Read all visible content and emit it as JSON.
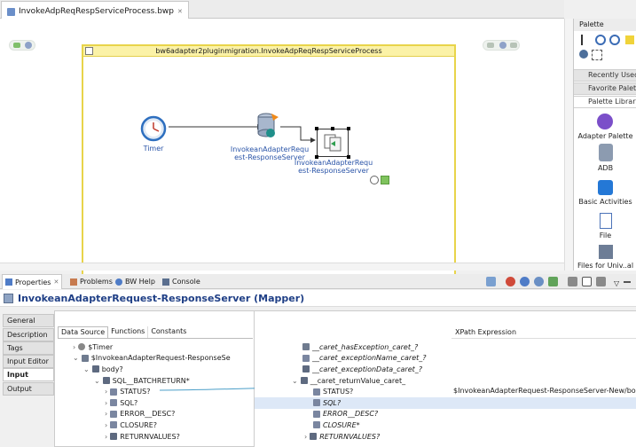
{
  "editor": {
    "tab_title": "InvokeAdpReqRespServiceProcess.bwp",
    "tab_close": "✕",
    "swimlane_title": "bw6adapter2pluginmigration.InvokeAdpReqRespServiceProcess",
    "nodes": {
      "timer": "Timer",
      "invoke_line1": "InvokeanAdapterRequ",
      "invoke_line2": "est-ResponseServer",
      "invoke2_line1": "InvokeanAdapterRequ",
      "invoke2_line2": "est-ResponseServer"
    }
  },
  "palette": {
    "title": "Palette",
    "sections": [
      "Recently Used",
      "Favorite Palet...",
      "Palette Library"
    ],
    "items": [
      "Adapter Palette",
      "ADB",
      "Basic Activities",
      "File",
      "Files for Univ..al"
    ]
  },
  "properties": {
    "tabs": [
      "Properties",
      "Problems",
      "BW Help",
      "Console"
    ],
    "title": "InvokeanAdapterRequest-ResponseServer (Mapper)",
    "side_tabs": [
      "General",
      "Description",
      "Tags",
      "Input Editor",
      "Input",
      "Output"
    ],
    "left_tabs": [
      "Data Source",
      "Functions",
      "Constants"
    ],
    "left_tree": [
      "$Timer",
      "$InvokeanAdapterRequest-ResponseSe",
      "body?",
      "SQL__BATCHRETURN*",
      "STATUS?",
      "SQL?",
      "ERROR__DESC?",
      "CLOSURE?",
      "RETURNVALUES?"
    ],
    "right_header": "XPath Expression",
    "right_tree": [
      "__caret_hasException_caret_?",
      "__caret_exceptionName_caret_?",
      "__caret_exceptionData_caret_?",
      "__caret_returnValue_caret_",
      "STATUS?",
      "SQL?",
      "ERROR__DESC?",
      "CLOSURE*",
      "RETURNVALUES?"
    ],
    "xpath_status": "$InvokeanAdapterRequest-ResponseServer-New/bod..."
  },
  "colors": {
    "accent": "#2b55a8",
    "swimlane": "#e8d44a",
    "selection": "#dde8f7"
  }
}
